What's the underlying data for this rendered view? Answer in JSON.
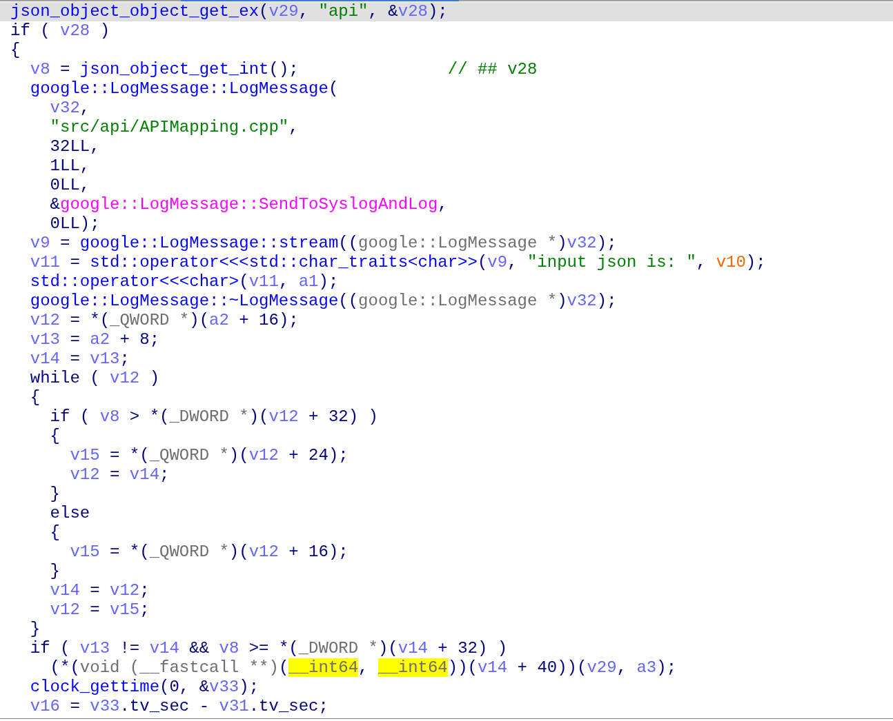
{
  "pseudocode_view": {
    "lines": [
      {
        "selected": true,
        "tokens": [
          {
            "kind": "fn",
            "text": "json_object_object_get_ex"
          },
          {
            "kind": "p",
            "text": "("
          },
          {
            "kind": "v",
            "text": "v29"
          },
          {
            "kind": "p",
            "text": ", "
          },
          {
            "kind": "s",
            "text": "\"api\""
          },
          {
            "kind": "p",
            "text": ", &"
          },
          {
            "kind": "v",
            "text": "v28"
          },
          {
            "kind": "p",
            "text": ");"
          }
        ]
      },
      {
        "selected": false,
        "tokens": [
          {
            "kind": "p",
            "text": "if ( "
          },
          {
            "kind": "v",
            "text": "v28"
          },
          {
            "kind": "p",
            "text": " )"
          }
        ]
      },
      {
        "selected": false,
        "tokens": [
          {
            "kind": "p",
            "text": "{"
          }
        ]
      },
      {
        "selected": false,
        "tokens": [
          {
            "kind": "v",
            "text": "  v8"
          },
          {
            "kind": "p",
            "text": " = "
          },
          {
            "kind": "fn",
            "text": "json_object_get_int"
          },
          {
            "kind": "p",
            "text": "();               "
          },
          {
            "kind": "c",
            "text": "// ## v28"
          }
        ]
      },
      {
        "selected": false,
        "tokens": [
          {
            "kind": "fn",
            "text": "  google::LogMessage::LogMessage"
          },
          {
            "kind": "p",
            "text": "("
          }
        ]
      },
      {
        "selected": false,
        "tokens": [
          {
            "kind": "v",
            "text": "    v32"
          },
          {
            "kind": "p",
            "text": ","
          }
        ]
      },
      {
        "selected": false,
        "tokens": [
          {
            "kind": "s",
            "text": "    \"src/api/APIMapping.cpp\""
          },
          {
            "kind": "p",
            "text": ","
          }
        ]
      },
      {
        "selected": false,
        "tokens": [
          {
            "kind": "p",
            "text": "    32LL,"
          }
        ]
      },
      {
        "selected": false,
        "tokens": [
          {
            "kind": "p",
            "text": "    1LL,"
          }
        ]
      },
      {
        "selected": false,
        "tokens": [
          {
            "kind": "p",
            "text": "    0LL,"
          }
        ]
      },
      {
        "selected": false,
        "tokens": [
          {
            "kind": "p",
            "text": "    &"
          },
          {
            "kind": "i",
            "text": "google::LogMessage::SendToSyslogAndLog"
          },
          {
            "kind": "p",
            "text": ","
          }
        ]
      },
      {
        "selected": false,
        "tokens": [
          {
            "kind": "p",
            "text": "    0LL);"
          }
        ]
      },
      {
        "selected": false,
        "tokens": [
          {
            "kind": "v",
            "text": "  v9"
          },
          {
            "kind": "p",
            "text": " = "
          },
          {
            "kind": "fn",
            "text": "google::LogMessage::stream"
          },
          {
            "kind": "p",
            "text": "(("
          },
          {
            "kind": "t",
            "text": "google::LogMessage *"
          },
          {
            "kind": "p",
            "text": ")"
          },
          {
            "kind": "v",
            "text": "v32"
          },
          {
            "kind": "p",
            "text": ");"
          }
        ]
      },
      {
        "selected": false,
        "tokens": [
          {
            "kind": "v",
            "text": "  v11"
          },
          {
            "kind": "p",
            "text": " = "
          },
          {
            "kind": "fn",
            "text": "std::operator<<<std::char_traits<char>>"
          },
          {
            "kind": "p",
            "text": "("
          },
          {
            "kind": "v",
            "text": "v9"
          },
          {
            "kind": "p",
            "text": ", "
          },
          {
            "kind": "s",
            "text": "\"input json is: \""
          },
          {
            "kind": "p",
            "text": ", "
          },
          {
            "kind": "g",
            "text": "v10"
          },
          {
            "kind": "p",
            "text": ");"
          }
        ]
      },
      {
        "selected": false,
        "tokens": [
          {
            "kind": "fn",
            "text": "  std::operator<<<char>"
          },
          {
            "kind": "p",
            "text": "("
          },
          {
            "kind": "v",
            "text": "v11"
          },
          {
            "kind": "p",
            "text": ", "
          },
          {
            "kind": "v",
            "text": "a1"
          },
          {
            "kind": "p",
            "text": ");"
          }
        ]
      },
      {
        "selected": false,
        "tokens": [
          {
            "kind": "fn",
            "text": "  google::LogMessage::~LogMessage"
          },
          {
            "kind": "p",
            "text": "(("
          },
          {
            "kind": "t",
            "text": "google::LogMessage *"
          },
          {
            "kind": "p",
            "text": ")"
          },
          {
            "kind": "v",
            "text": "v32"
          },
          {
            "kind": "p",
            "text": ");"
          }
        ]
      },
      {
        "selected": false,
        "tokens": [
          {
            "kind": "v",
            "text": "  v12"
          },
          {
            "kind": "p",
            "text": " = *("
          },
          {
            "kind": "t",
            "text": "_QWORD *"
          },
          {
            "kind": "p",
            "text": ")("
          },
          {
            "kind": "v",
            "text": "a2"
          },
          {
            "kind": "p",
            "text": " + 16);"
          }
        ]
      },
      {
        "selected": false,
        "tokens": [
          {
            "kind": "v",
            "text": "  v13"
          },
          {
            "kind": "p",
            "text": " = "
          },
          {
            "kind": "v",
            "text": "a2"
          },
          {
            "kind": "p",
            "text": " + 8;"
          }
        ]
      },
      {
        "selected": false,
        "tokens": [
          {
            "kind": "v",
            "text": "  v14"
          },
          {
            "kind": "p",
            "text": " = "
          },
          {
            "kind": "v",
            "text": "v13"
          },
          {
            "kind": "p",
            "text": ";"
          }
        ]
      },
      {
        "selected": false,
        "tokens": [
          {
            "kind": "p",
            "text": "  while ( "
          },
          {
            "kind": "v",
            "text": "v12"
          },
          {
            "kind": "p",
            "text": " )"
          }
        ]
      },
      {
        "selected": false,
        "tokens": [
          {
            "kind": "p",
            "text": "  {"
          }
        ]
      },
      {
        "selected": false,
        "tokens": [
          {
            "kind": "p",
            "text": "    if ( "
          },
          {
            "kind": "v",
            "text": "v8"
          },
          {
            "kind": "p",
            "text": " > *("
          },
          {
            "kind": "t",
            "text": "_DWORD *"
          },
          {
            "kind": "p",
            "text": ")("
          },
          {
            "kind": "v",
            "text": "v12"
          },
          {
            "kind": "p",
            "text": " + 32) )"
          }
        ]
      },
      {
        "selected": false,
        "tokens": [
          {
            "kind": "p",
            "text": "    {"
          }
        ]
      },
      {
        "selected": false,
        "tokens": [
          {
            "kind": "v",
            "text": "      v15"
          },
          {
            "kind": "p",
            "text": " = *("
          },
          {
            "kind": "t",
            "text": "_QWORD *"
          },
          {
            "kind": "p",
            "text": ")("
          },
          {
            "kind": "v",
            "text": "v12"
          },
          {
            "kind": "p",
            "text": " + 24);"
          }
        ]
      },
      {
        "selected": false,
        "tokens": [
          {
            "kind": "v",
            "text": "      v12"
          },
          {
            "kind": "p",
            "text": " = "
          },
          {
            "kind": "v",
            "text": "v14"
          },
          {
            "kind": "p",
            "text": ";"
          }
        ]
      },
      {
        "selected": false,
        "tokens": [
          {
            "kind": "p",
            "text": "    }"
          }
        ]
      },
      {
        "selected": false,
        "tokens": [
          {
            "kind": "p",
            "text": "    else"
          }
        ]
      },
      {
        "selected": false,
        "tokens": [
          {
            "kind": "p",
            "text": "    {"
          }
        ]
      },
      {
        "selected": false,
        "tokens": [
          {
            "kind": "v",
            "text": "      v15"
          },
          {
            "kind": "p",
            "text": " = *("
          },
          {
            "kind": "t",
            "text": "_QWORD *"
          },
          {
            "kind": "p",
            "text": ")("
          },
          {
            "kind": "v",
            "text": "v12"
          },
          {
            "kind": "p",
            "text": " + 16);"
          }
        ]
      },
      {
        "selected": false,
        "tokens": [
          {
            "kind": "p",
            "text": "    }"
          }
        ]
      },
      {
        "selected": false,
        "tokens": [
          {
            "kind": "v",
            "text": "    v14"
          },
          {
            "kind": "p",
            "text": " = "
          },
          {
            "kind": "v",
            "text": "v12"
          },
          {
            "kind": "p",
            "text": ";"
          }
        ]
      },
      {
        "selected": false,
        "tokens": [
          {
            "kind": "v",
            "text": "    v12"
          },
          {
            "kind": "p",
            "text": " = "
          },
          {
            "kind": "v",
            "text": "v15"
          },
          {
            "kind": "p",
            "text": ";"
          }
        ]
      },
      {
        "selected": false,
        "tokens": [
          {
            "kind": "p",
            "text": "  }"
          }
        ]
      },
      {
        "selected": false,
        "tokens": [
          {
            "kind": "p",
            "text": "  if ( "
          },
          {
            "kind": "v",
            "text": "v13"
          },
          {
            "kind": "p",
            "text": " != "
          },
          {
            "kind": "v",
            "text": "v14"
          },
          {
            "kind": "p",
            "text": " && "
          },
          {
            "kind": "v",
            "text": "v8"
          },
          {
            "kind": "p",
            "text": " >= *("
          },
          {
            "kind": "t",
            "text": "_DWORD *"
          },
          {
            "kind": "p",
            "text": ")("
          },
          {
            "kind": "v",
            "text": "v14"
          },
          {
            "kind": "p",
            "text": " + 32) )"
          }
        ]
      },
      {
        "selected": false,
        "tokens": [
          {
            "kind": "p",
            "text": "    (*("
          },
          {
            "kind": "t",
            "text": "void (__fastcall **)"
          },
          {
            "kind": "p",
            "text": "("
          },
          {
            "kind": "h",
            "text": "__int64"
          },
          {
            "kind": "p",
            "text": ", "
          },
          {
            "kind": "h",
            "text": "__int64"
          },
          {
            "kind": "p",
            "text": "))("
          },
          {
            "kind": "v",
            "text": "v14"
          },
          {
            "kind": "p",
            "text": " + 40))("
          },
          {
            "kind": "v",
            "text": "v29"
          },
          {
            "kind": "p",
            "text": ", "
          },
          {
            "kind": "v",
            "text": "a3"
          },
          {
            "kind": "p",
            "text": ");"
          }
        ]
      },
      {
        "selected": false,
        "tokens": [
          {
            "kind": "fn",
            "text": "  clock_gettime"
          },
          {
            "kind": "p",
            "text": "(0, &"
          },
          {
            "kind": "v",
            "text": "v33"
          },
          {
            "kind": "p",
            "text": ");"
          }
        ]
      },
      {
        "selected": false,
        "tokens": [
          {
            "kind": "v",
            "text": "  v16"
          },
          {
            "kind": "p",
            "text": " = "
          },
          {
            "kind": "v",
            "text": "v33"
          },
          {
            "kind": "p",
            "text": ".tv_sec - "
          },
          {
            "kind": "v",
            "text": "v31"
          },
          {
            "kind": "p",
            "text": ".tv_sec;"
          }
        ]
      }
    ]
  }
}
